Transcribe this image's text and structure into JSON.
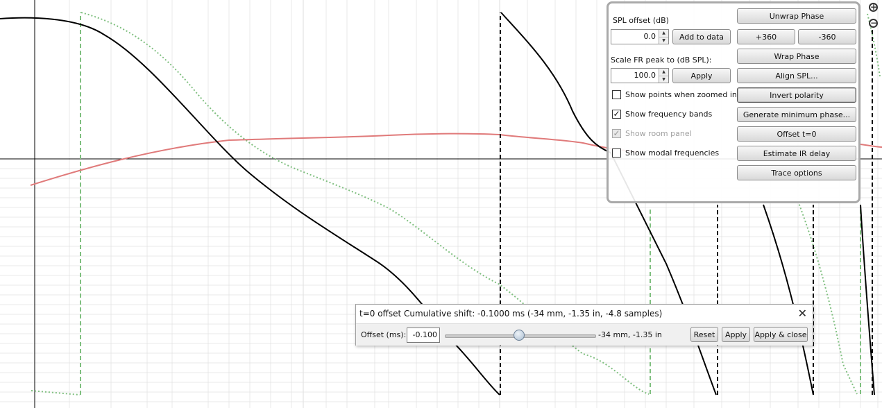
{
  "controls": {
    "spl_offset_label": "SPL offset (dB)",
    "spl_offset_value": "0.0",
    "add_to_data_label": "Add to data",
    "scale_fr_label": "Scale FR peak to (dB SPL):",
    "scale_fr_value": "100.0",
    "apply_label": "Apply",
    "checkboxes": [
      {
        "label": "Show points when zoomed in",
        "checked": false,
        "enabled": true
      },
      {
        "label": "Show frequency bands",
        "checked": true,
        "enabled": true
      },
      {
        "label": "Show room panel",
        "checked": true,
        "enabled": false
      },
      {
        "label": "Show modal frequencies",
        "checked": false,
        "enabled": true
      }
    ],
    "buttons": {
      "unwrap_phase": "Unwrap Phase",
      "plus_360": "+360",
      "minus_360": "-360",
      "wrap_phase": "Wrap Phase",
      "align_spl": "Align SPL...",
      "invert_polarity": "Invert polarity",
      "generate_min_phase": "Generate minimum phase...",
      "offset_t0": "Offset t=0",
      "estimate_ir_delay": "Estimate IR delay",
      "trace_options": "Trace options"
    }
  },
  "zoom": {
    "in_icon": "zoom-in-icon",
    "out_icon": "zoom-out-icon"
  },
  "offset_dialog": {
    "title": "t=0 offset  Cumulative shift: -0.1000 ms (-34 mm, -1.35 in, -4.8 samples)",
    "offset_label": "Offset (ms):",
    "offset_value": "-0.100",
    "slider_value_fraction": 0.5,
    "slider_readout": "-34 mm, -1.35 in",
    "reset_label": "Reset",
    "apply_label": "Apply",
    "apply_close_label": "Apply & close",
    "close_icon": "close-icon"
  },
  "colors": {
    "phase_trace": "#000000",
    "min_phase_trace": "#7fbf7f",
    "spl_trace": "#e07a7a",
    "grid": "#e3e3e3",
    "axis": "#000000"
  }
}
